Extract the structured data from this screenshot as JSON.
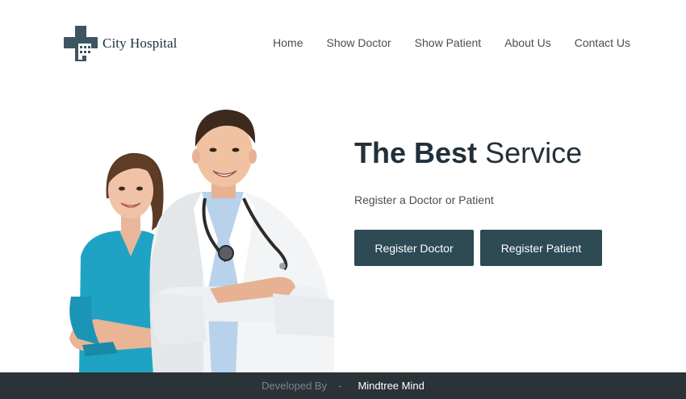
{
  "brand": {
    "name": "City Hospital"
  },
  "nav": {
    "items": [
      {
        "label": "Home"
      },
      {
        "label": "Show Doctor"
      },
      {
        "label": "Show Patient"
      },
      {
        "label": "About Us"
      },
      {
        "label": "Contact Us"
      }
    ]
  },
  "hero": {
    "title_bold": "The Best",
    "title_rest": "Service",
    "subtitle": "Register a Doctor or Patient",
    "register_doctor_label": "Register Doctor",
    "register_patient_label": "Register Patient"
  },
  "footer": {
    "developed_by": "Developed By",
    "separator": "-",
    "author": "Mindtree Mind"
  },
  "colors": {
    "primary": "#2d4a55",
    "footer_bg": "#2a3338",
    "heading": "#22303a",
    "nurse_scrubs": "#1fa3c4",
    "doctor_coat": "#f2f4f5"
  },
  "icons": [
    "medical-cross-logo-icon"
  ]
}
